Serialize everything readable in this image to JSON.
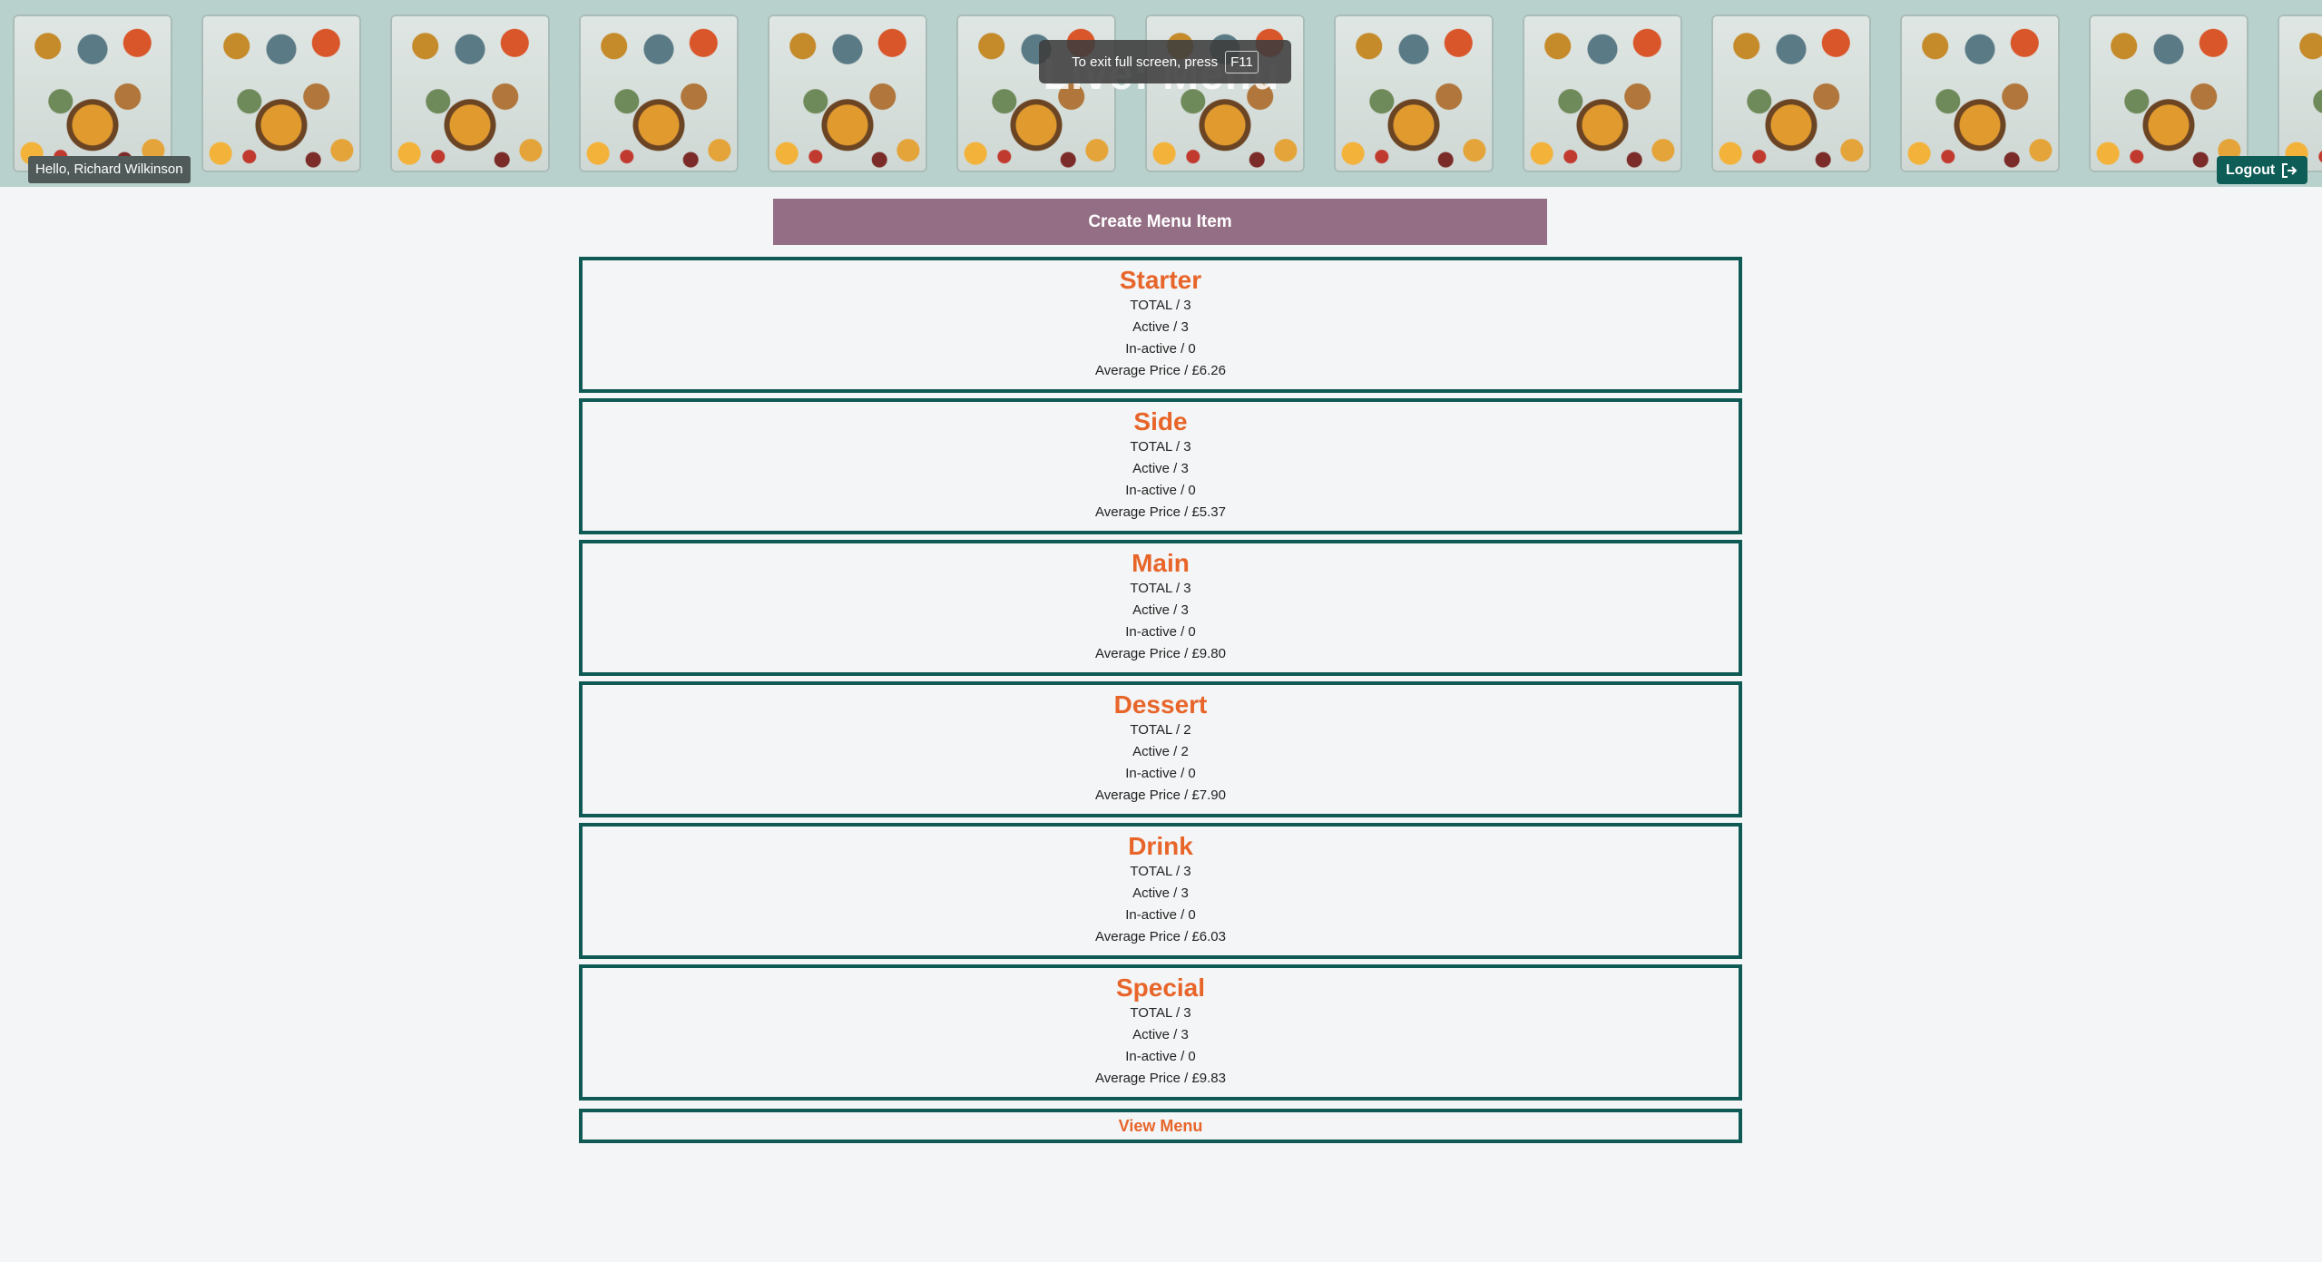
{
  "header": {
    "title": "Live: Menu",
    "greeting": "Hello, Richard Wilkinson",
    "logout_label": "Logout",
    "fullscreen_notice": "To exit full screen, press",
    "fullscreen_key": "F11"
  },
  "actions": {
    "create_label": "Create Menu Item",
    "view_label": "View Menu"
  },
  "categories": [
    {
      "name": "Starter",
      "total": "TOTAL / 3",
      "active": "Active / 3",
      "inactive": "In-active / 0",
      "avg": "Average Price / £6.26"
    },
    {
      "name": "Side",
      "total": "TOTAL / 3",
      "active": "Active / 3",
      "inactive": "In-active / 0",
      "avg": "Average Price / £5.37"
    },
    {
      "name": "Main",
      "total": "TOTAL / 3",
      "active": "Active / 3",
      "inactive": "In-active / 0",
      "avg": "Average Price / £9.80"
    },
    {
      "name": "Dessert",
      "total": "TOTAL / 2",
      "active": "Active / 2",
      "inactive": "In-active / 0",
      "avg": "Average Price / £7.90"
    },
    {
      "name": "Drink",
      "total": "TOTAL / 3",
      "active": "Active / 3",
      "inactive": "In-active / 0",
      "avg": "Average Price / £6.03"
    },
    {
      "name": "Special",
      "total": "TOTAL / 3",
      "active": "Active / 3",
      "inactive": "In-active / 0",
      "avg": "Average Price / £9.83"
    }
  ],
  "colors": {
    "accent": "#e8652a",
    "primary": "#105a55",
    "create_button": "#946e84",
    "header_bg": "#b9d1cd"
  },
  "icons": {
    "logout": "logout-icon",
    "banner": "food-illustration-banner"
  }
}
